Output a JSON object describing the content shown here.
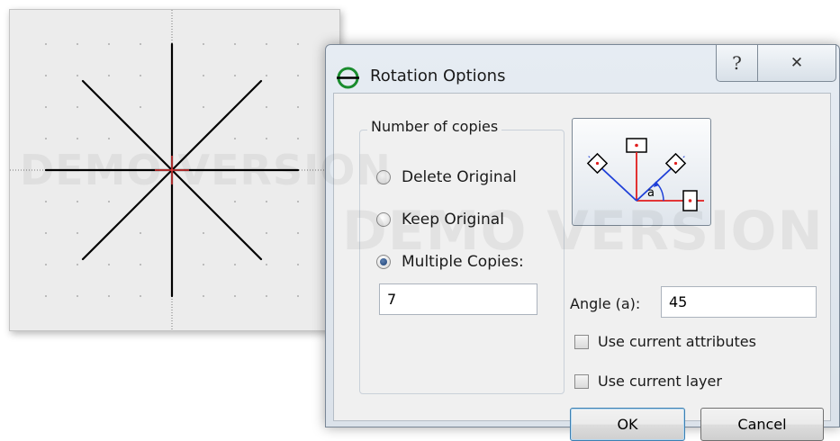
{
  "watermark": "DEMO VERSION",
  "canvas": {
    "star_line_color": "#000000",
    "origin_marker_color": "#e33b3b"
  },
  "dialog": {
    "title": "Rotation Options",
    "title_icon": "rotation-icon",
    "help_glyph": "?",
    "close_glyph": "✕",
    "copies_group": {
      "legend": "Number of copies",
      "options": [
        {
          "label": "Delete Original",
          "checked": false
        },
        {
          "label": "Keep Original",
          "checked": false
        },
        {
          "label": "Multiple Copies:",
          "checked": true
        }
      ],
      "copies_value": "7"
    },
    "diagram": {
      "angle_marker": "a",
      "icon": "rotation-diagram-icon"
    },
    "angle": {
      "label": "Angle (a):",
      "value": "45"
    },
    "checkboxes": [
      {
        "label": "Use current attributes",
        "checked": false
      },
      {
        "label": "Use current layer",
        "checked": false
      }
    ],
    "buttons": {
      "ok": "OK",
      "cancel": "Cancel"
    }
  },
  "colors": {
    "dialog_border": "#7a8796",
    "diagram_red": "#e11d1d",
    "diagram_blue": "#1e3fd8"
  }
}
